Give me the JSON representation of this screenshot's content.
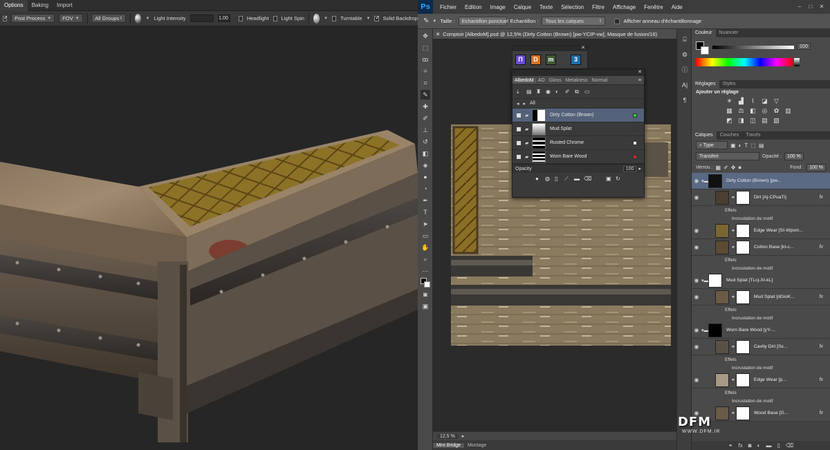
{
  "viewer": {
    "tabs": [
      "Options",
      "Baking",
      "Import"
    ],
    "toolbar": {
      "post_process": "Post Process",
      "fov": "FOV",
      "groups": "All Groups",
      "light_intensity": "Light Intensity",
      "light_value": "1.00",
      "headlight": "Headlight",
      "light_spin": "Light Spin",
      "turntable": "Turntable",
      "solid_backdrop": "Solid Backdrop"
    }
  },
  "photoshop": {
    "logo": "Ps",
    "menus": [
      "Fichier",
      "Edition",
      "Image",
      "Calque",
      "Texte",
      "Sélection",
      "Filtre",
      "Affichage",
      "Fenêtre",
      "Aide"
    ],
    "options_bar": {
      "taille_label": "Taille :",
      "taille_value": "Echantillon ponctuel",
      "echantillon_label": "Echantillon :",
      "echantillon_value": "Tous les calques",
      "ring_label": "Afficher anneau d'échantillonnage"
    },
    "doc_tab": "Comptoir [AlbedoM].psd @ 12,5% (Dirty Cotton (Brown) [pw-YCIP-vw], Masque de fusion/16)",
    "zoom": "12,5 %",
    "bottom_tabs": [
      "Mini Bridge",
      "Montage"
    ],
    "substance_panel": {
      "launcher": [
        "П",
        "D",
        "m",
        "3"
      ],
      "tabs": [
        "AlbedoM",
        "AO",
        "Gloss",
        "Metalness",
        "Normal"
      ],
      "crumb": "All",
      "rows": [
        {
          "name": "Dirty Cotton (Brown)",
          "swatch": "#2ecc40"
        },
        {
          "name": "Mud Splat",
          "swatch": "#3a3a3a"
        },
        {
          "name": "Rusted Chrome",
          "swatch": "#ffffff"
        },
        {
          "name": "Worn Bare Wood",
          "swatch": "#d62828"
        }
      ],
      "opacity_label": "Opacity",
      "opacity_value": "100"
    },
    "color_panel": {
      "tabs": [
        "Couleur",
        "Nuancier"
      ],
      "value": "100"
    },
    "adjust_panel": {
      "tabs": [
        "Réglages",
        "Styles"
      ],
      "title": "Ajouter un réglage"
    },
    "layers_panel": {
      "tabs": [
        "Calques",
        "Couches",
        "Tracés"
      ],
      "filter": "Type",
      "blend": "Transfert",
      "opacity_label": "Opacité :",
      "opacity_value": "100 %",
      "lock_label": "Verrou :",
      "fill_label": "Fond :",
      "fill_value": "100 %",
      "layers": [
        {
          "name": "Dirty Cotton (Brown) [pw...",
          "kind": "group",
          "thumb": "#111",
          "sel": true
        },
        {
          "name": "Dirt [Aj-CPuaTi]",
          "kind": "layer",
          "thumb": "#4a3f30",
          "fx": "fx"
        },
        {
          "sub": "Effets"
        },
        {
          "sub": "Incrustation de motif"
        },
        {
          "name": "Edge Wear [SI-Wpxm...",
          "kind": "layer",
          "thumb": "#7a6630",
          "fx": ""
        },
        {
          "name": "Cotton Base [kt-c...",
          "kind": "layer",
          "thumb": "#5b4b33",
          "fx": "fx"
        },
        {
          "sub": "Effets"
        },
        {
          "sub": "Incrustation de motif"
        },
        {
          "name": "Mud Splat [TLcj-XI-kL]",
          "kind": "group",
          "thumb": "#fff"
        },
        {
          "name": "Mud Splat [dGioK...",
          "kind": "layer",
          "thumb": "#6b5a46",
          "fx": "fx"
        },
        {
          "sub": "Effets"
        },
        {
          "sub": "Incrustation de motif"
        },
        {
          "name": "Worn Bare Wood [yY-...",
          "kind": "group",
          "thumb": "#000"
        },
        {
          "name": "Cavity Dirt [Sx...",
          "kind": "layer",
          "thumb": "#5a5146",
          "fx": "fx"
        },
        {
          "sub": "Effets"
        },
        {
          "sub": "Incrustation de motif"
        },
        {
          "name": "Edge Wear [p...",
          "kind": "layer",
          "thumb": "#a89886",
          "fx": "fx"
        },
        {
          "sub": "Effets"
        },
        {
          "sub": "Incrustation de motif"
        },
        {
          "name": "Wood Base [G...",
          "kind": "layer",
          "thumb": "#6a5a48",
          "fx": "fx"
        }
      ]
    }
  },
  "watermark": {
    "main": "DFM",
    "sub": "WWW.DFM.IR"
  }
}
